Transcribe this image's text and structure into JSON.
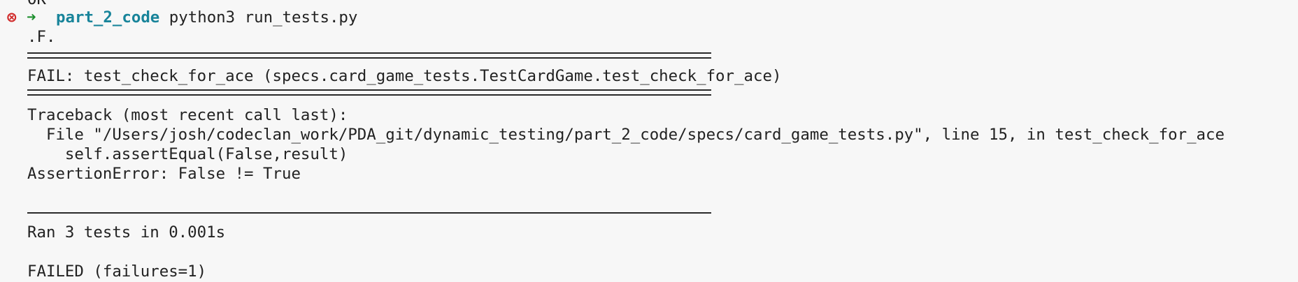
{
  "terminal": {
    "previous_output": "OK",
    "prompt": {
      "error_icon": "⊗",
      "arrow_icon": "➜",
      "cwd": "part_2_code",
      "command": "python3 run_tests.py"
    },
    "progress": ".F.",
    "fail_header": "FAIL: test_check_for_ace (specs.card_game_tests.TestCardGame.test_check_for_ace)",
    "traceback_title": "Traceback (most recent call last):",
    "traceback_file": "  File \"/Users/josh/codeclan_work/PDA_git/dynamic_testing/part_2_code/specs/card_game_tests.py\", line 15, in test_check_for_ace",
    "traceback_code": "    self.assertEqual(False,result)",
    "assertion": "AssertionError: False != True",
    "summary": "Ran 3 tests in 0.001s",
    "result": "FAILED (failures=1)"
  },
  "colors": {
    "background": "#f7f7f7",
    "text": "#222222",
    "error_icon": "#d12a2a",
    "arrow": "#1e8f2e",
    "cwd": "#18849a"
  }
}
